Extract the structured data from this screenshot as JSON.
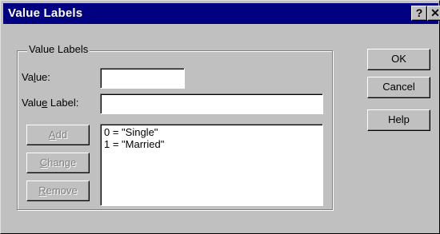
{
  "window": {
    "title": "Value Labels",
    "help_button": "?",
    "close_button": "✕"
  },
  "group": {
    "legend": "Value Labels",
    "value_label_pre": "Va",
    "value_label_ul": "l",
    "value_label_post": "ue:",
    "value_input": "",
    "vlabel_pre": "Valu",
    "vlabel_ul": "e",
    "vlabel_post": " Label:",
    "vlabel_input": ""
  },
  "list": {
    "items": [
      "0 = \"Single\"",
      "1 = \"Married\""
    ]
  },
  "buttons": {
    "add_ul": "A",
    "add_rest": "dd",
    "change_ul": "C",
    "change_rest": "hange",
    "remove_ul": "R",
    "remove_rest": "emove",
    "ok": "OK",
    "cancel": "Cancel",
    "help": "Help"
  }
}
